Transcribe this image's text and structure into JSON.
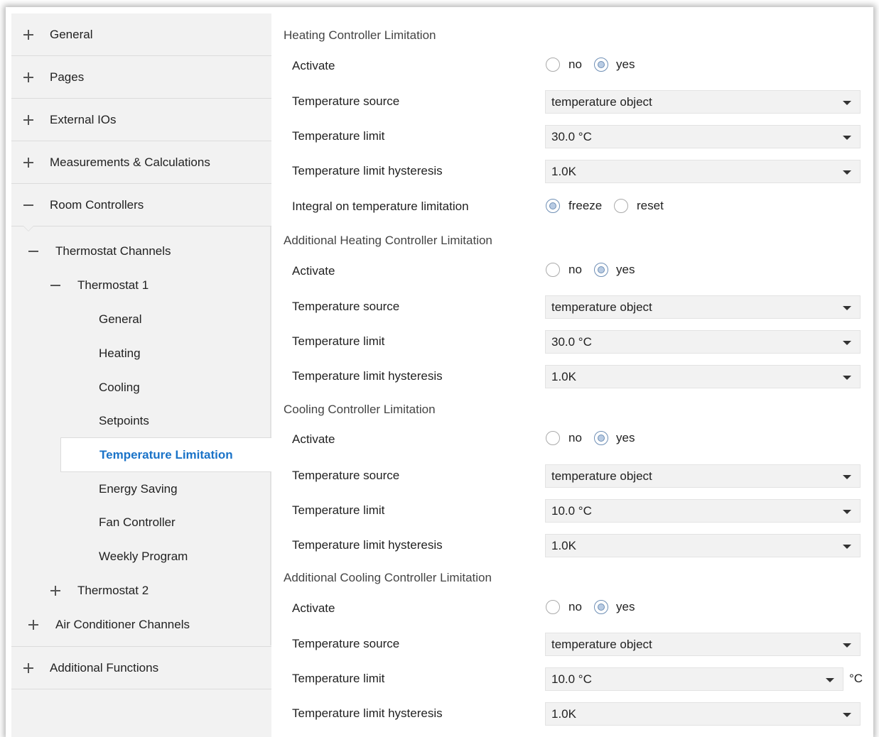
{
  "sidebar": {
    "top_items": [
      {
        "label": "General",
        "state": "collapsed"
      },
      {
        "label": "Pages",
        "state": "collapsed"
      },
      {
        "label": "External IOs",
        "state": "collapsed"
      },
      {
        "label": "Measurements & Calculations",
        "state": "collapsed"
      },
      {
        "label": "Room Controllers",
        "state": "expanded"
      },
      {
        "label": "Additional Functions",
        "state": "collapsed"
      }
    ],
    "thermostat_channels": "Thermostat Channels",
    "thermostat_1": "Thermostat 1",
    "thermostat_1_children": [
      "General",
      "Heating",
      "Cooling",
      "Setpoints",
      "Temperature Limitation",
      "Energy Saving",
      "Fan Controller",
      "Weekly Program"
    ],
    "selected": "Temperature Limitation",
    "thermostat_2": "Thermostat 2",
    "air_conditioner_channels": "Air Conditioner Channels"
  },
  "sections": [
    {
      "title": "Heating Controller Limitation",
      "activate_label": "Activate",
      "activate_options": [
        "no",
        "yes"
      ],
      "activate_value": "yes",
      "source_label": "Temperature source",
      "source_value": "temperature object",
      "limit_label": "Temperature limit",
      "limit_value": "30.0 °C",
      "hyst_label": "Temperature limit hysteresis",
      "hyst_value": "1.0K",
      "integral_label": "Integral on temperature limitation",
      "integral_options": [
        "freeze",
        "reset"
      ],
      "integral_value": "freeze"
    },
    {
      "title": "Additional Heating Controller Limitation",
      "activate_label": "Activate",
      "activate_options": [
        "no",
        "yes"
      ],
      "activate_value": "yes",
      "source_label": "Temperature source",
      "source_value": "temperature object",
      "limit_label": "Temperature limit",
      "limit_value": "30.0 °C",
      "hyst_label": "Temperature limit hysteresis",
      "hyst_value": "1.0K"
    },
    {
      "title": "Cooling Controller Limitation",
      "activate_label": "Activate",
      "activate_options": [
        "no",
        "yes"
      ],
      "activate_value": "yes",
      "source_label": "Temperature source",
      "source_value": "temperature object",
      "limit_label": "Temperature limit",
      "limit_value": "10.0 °C",
      "hyst_label": "Temperature limit hysteresis",
      "hyst_value": "1.0K"
    },
    {
      "title": "Additional Cooling Controller Limitation",
      "activate_label": "Activate",
      "activate_options": [
        "no",
        "yes"
      ],
      "activate_value": "yes",
      "source_label": "Temperature source",
      "source_value": "temperature object",
      "limit_label": "Temperature limit",
      "limit_value": "10.0 °C",
      "limit_unit": "°C",
      "hyst_label": "Temperature limit hysteresis",
      "hyst_value": "1.0K"
    }
  ],
  "icons": {
    "expand": "plus-icon",
    "collapse": "minus-icon",
    "dropdown": "caret-down-icon"
  },
  "colors": {
    "selected_text": "#1a73c8",
    "sidebar_bg": "#f2f2f2",
    "select_bg": "#f2f2f2"
  }
}
